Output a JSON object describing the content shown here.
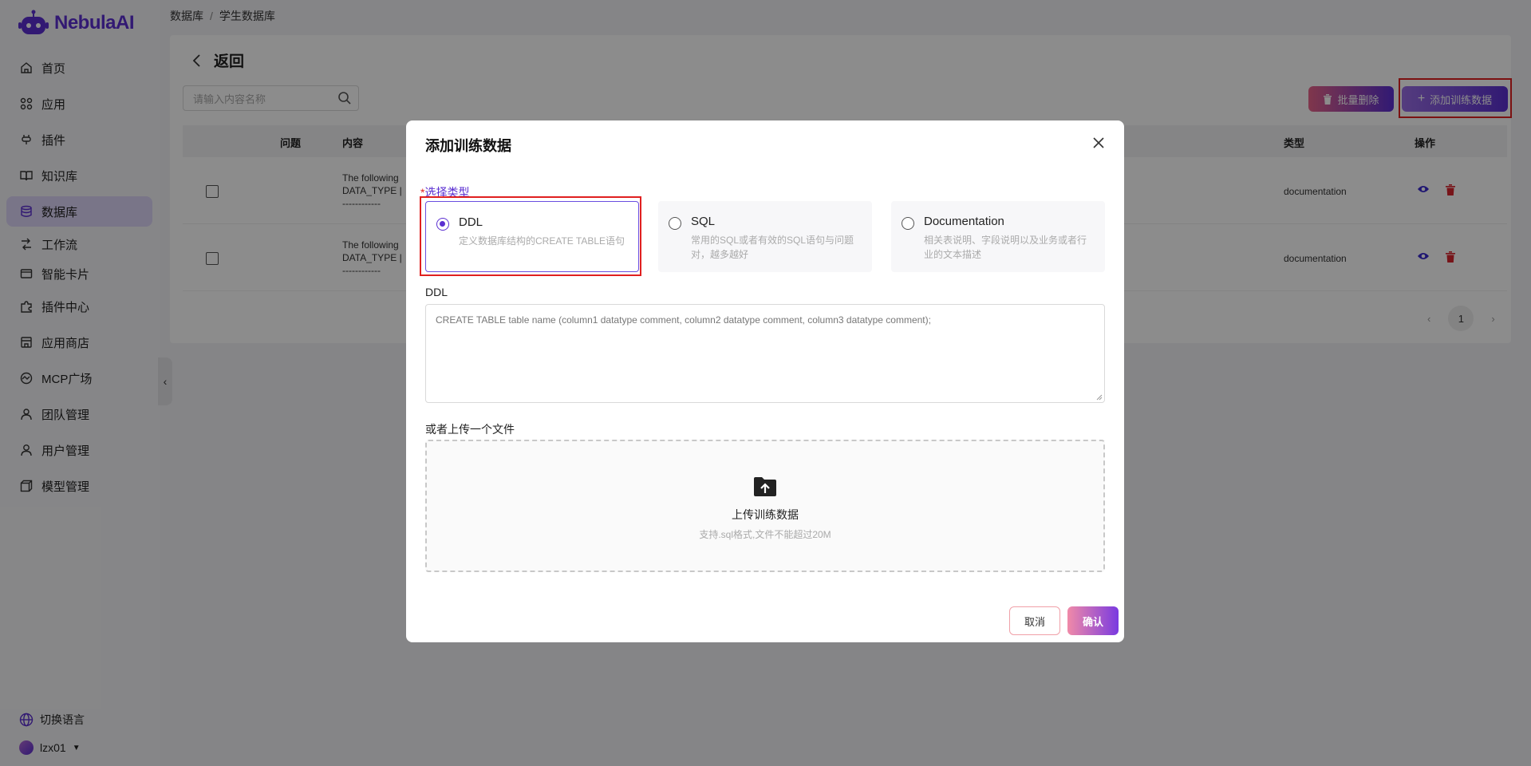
{
  "app": {
    "logo_text": "NebulaAI"
  },
  "sidebar": {
    "items": [
      {
        "label": "首页",
        "icon": "home-icon"
      },
      {
        "label": "应用",
        "icon": "apps-icon"
      },
      {
        "label": "插件",
        "icon": "plug-icon"
      },
      {
        "label": "知识库",
        "icon": "book-icon"
      },
      {
        "label": "数据库",
        "icon": "database-icon",
        "active": true
      },
      {
        "label": "工作流",
        "icon": "workflow-icon"
      },
      {
        "label": "智能卡片",
        "icon": "card-icon"
      },
      {
        "label": "插件中心",
        "icon": "puzzle-icon"
      },
      {
        "label": "应用商店",
        "icon": "store-icon"
      },
      {
        "label": "MCP广场",
        "icon": "mcp-icon"
      },
      {
        "label": "团队管理",
        "icon": "team-icon"
      },
      {
        "label": "用户管理",
        "icon": "user-icon"
      },
      {
        "label": "模型管理",
        "icon": "cube-icon"
      }
    ],
    "language_label": "切换语言",
    "username": "lzx01"
  },
  "breadcrumb": {
    "root": "数据库",
    "sep": "/",
    "current": "学生数据库"
  },
  "page": {
    "back_label": "返回",
    "search_placeholder": "请输入内容名称",
    "batch_delete_label": "批量删除",
    "add_training_label": "添加训练数据"
  },
  "table": {
    "headers": {
      "question": "问题",
      "content": "内容",
      "type": "类型",
      "ops": "操作"
    },
    "rows": [
      {
        "content": "The following\nDATA_TYPE | \n------------",
        "type": "documentation"
      },
      {
        "content": "The following\nDATA_TYPE | \n------------",
        "type": "documentation"
      }
    ],
    "current_page": "1"
  },
  "modal": {
    "title": "添加训练数据",
    "required_mark": "*",
    "type_label": "选择类型",
    "options": [
      {
        "name": "DDL",
        "desc": "定义数据库结构的CREATE TABLE语句",
        "selected": true
      },
      {
        "name": "SQL",
        "desc": "常用的SQL或者有效的SQL语句与问题对，越多越好",
        "selected": false
      },
      {
        "name": "Documentation",
        "desc": "相关表说明、字段说明以及业务或者行业的文本描述",
        "selected": false
      }
    ],
    "ddl_label": "DDL",
    "ddl_placeholder": "CREATE TABLE table name (column1 datatype comment, column2 datatype comment, column3 datatype comment);",
    "upload_label": "或者上传一个文件",
    "upload_title": "上传训练数据",
    "upload_hint": "支持.sql格式,文件不能超过20M",
    "cancel_label": "取消",
    "confirm_label": "确认"
  },
  "colors": {
    "accent": "#5b2fd1",
    "highlight": "#e02020",
    "danger": "#d9262e"
  }
}
